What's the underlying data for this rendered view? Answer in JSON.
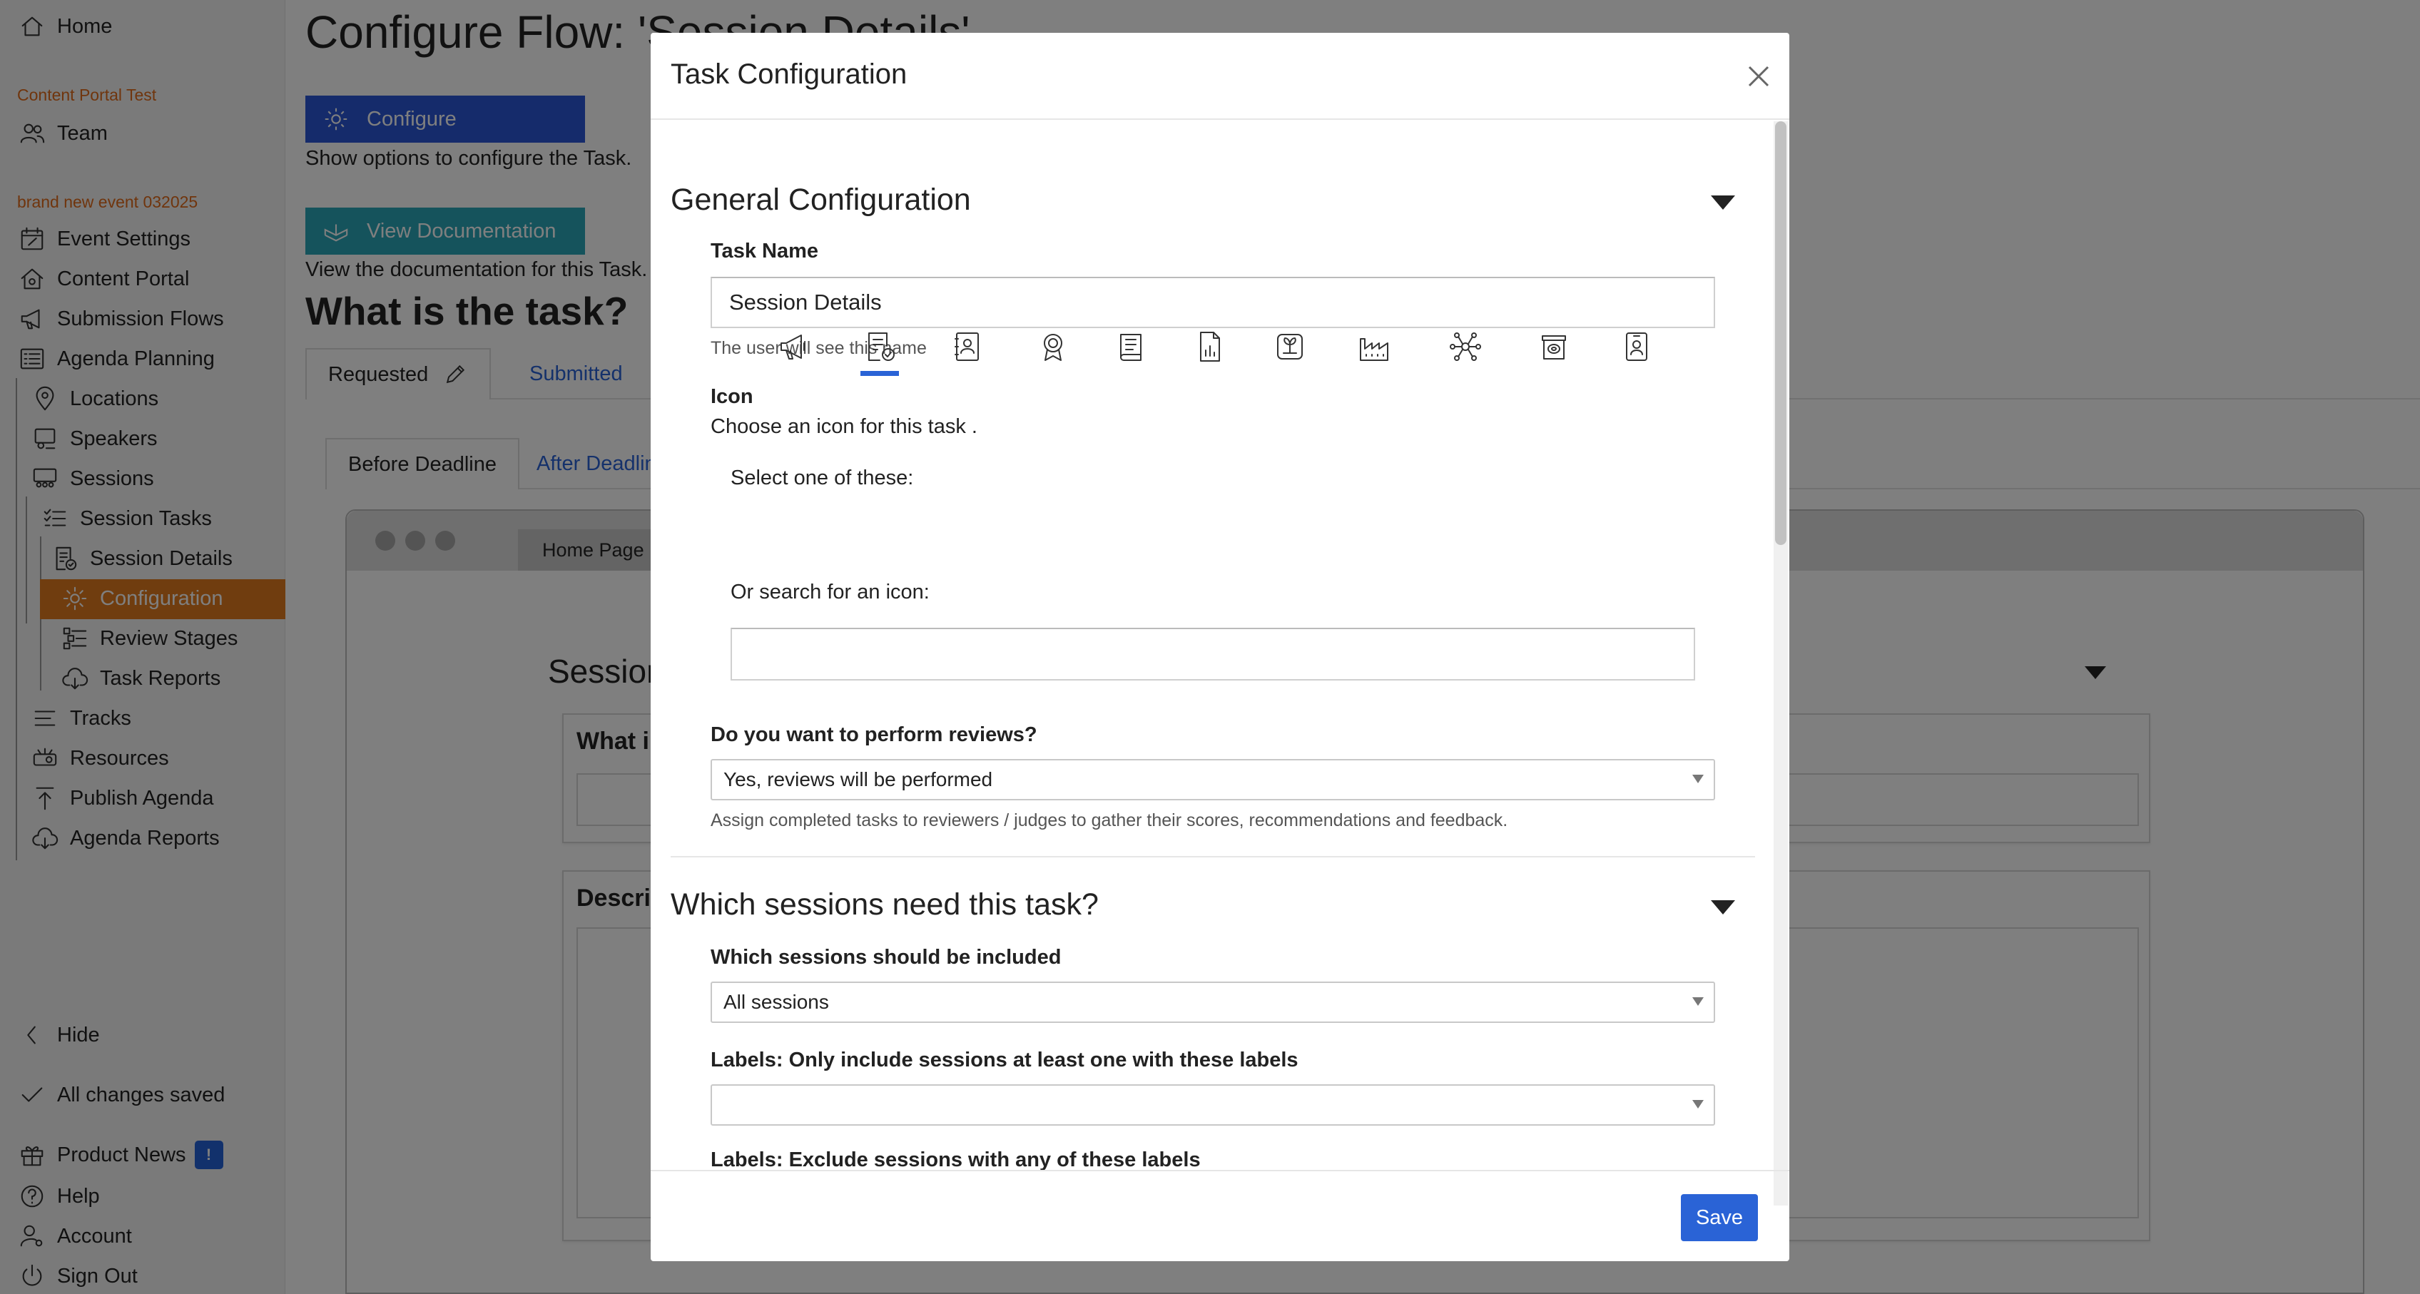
{
  "sidebar": {
    "home": "Home",
    "section1": "Content Portal Test",
    "team": "Team",
    "section2": "brand new event 032025",
    "items": {
      "event_settings": "Event Settings",
      "content_portal": "Content Portal",
      "submission_flows": "Submission Flows",
      "agenda_planning": "Agenda Planning",
      "locations": "Locations",
      "speakers": "Speakers",
      "sessions": "Sessions",
      "session_tasks": "Session Tasks",
      "session_details": "Session Details",
      "configuration": "Configuration",
      "review_stages": "Review Stages",
      "task_reports": "Task Reports",
      "tracks": "Tracks",
      "resources": "Resources",
      "publish_agenda": "Publish Agenda",
      "agenda_reports": "Agenda Reports"
    },
    "hide": "Hide",
    "saved_status": "All changes saved",
    "product_news": "Product News",
    "news_badge": "!",
    "help": "Help",
    "account": "Account",
    "sign_out": "Sign Out",
    "active_color": "#e07b1e"
  },
  "main": {
    "title": "Configure Flow: 'Session Details'",
    "configure_button": "Configure",
    "configure_help": "Show options to configure the Task.",
    "docs_button": "View Documentation",
    "docs_help": "View the documentation for this Task.",
    "question": "What is the task?",
    "tabs": [
      "Requested",
      "Submitted"
    ],
    "subtabs": [
      "Before Deadline",
      "After Deadline"
    ],
    "browser_tab": "Home Page",
    "preview_section_title": "Session",
    "preview_card1_title": "What i",
    "preview_card2_title": "Descri"
  },
  "modal": {
    "title": "Task Configuration",
    "general_section": "General Configuration",
    "task_name_label": "Task Name",
    "task_name_value": "Session Details",
    "task_name_hint": "The user will see this name",
    "icon_label": "Icon",
    "icon_desc": "Choose an icon for this task .",
    "select_one": "Select one of these:",
    "icon_options": [
      "megaphone-icon",
      "document-check-icon",
      "contact-card-icon",
      "award-icon",
      "book-icon",
      "report-chart-icon",
      "garden-icon",
      "factory-icon",
      "network-icon",
      "archive-box-icon",
      "id-badge-icon"
    ],
    "selected_icon": "document-check-icon",
    "search_label": "Or search for an icon:",
    "search_value": "",
    "reviews_label": "Do you want to perform reviews?",
    "reviews_value": "Yes, reviews will be performed",
    "reviews_hint": "Assign completed tasks to reviewers / judges to gather their scores, recommendations and feedback.",
    "sessions_section": "Which sessions need this task?",
    "sessions_label": "Which sessions should be included",
    "sessions_value": "All sessions",
    "include_labels_label": "Labels: Only include sessions at least one with these labels",
    "include_labels_value": "",
    "exclude_labels_label": "Labels: Exclude sessions with any of these labels",
    "exclude_labels_value": "",
    "save_button": "Save",
    "accent_color": "#2a63d6"
  }
}
